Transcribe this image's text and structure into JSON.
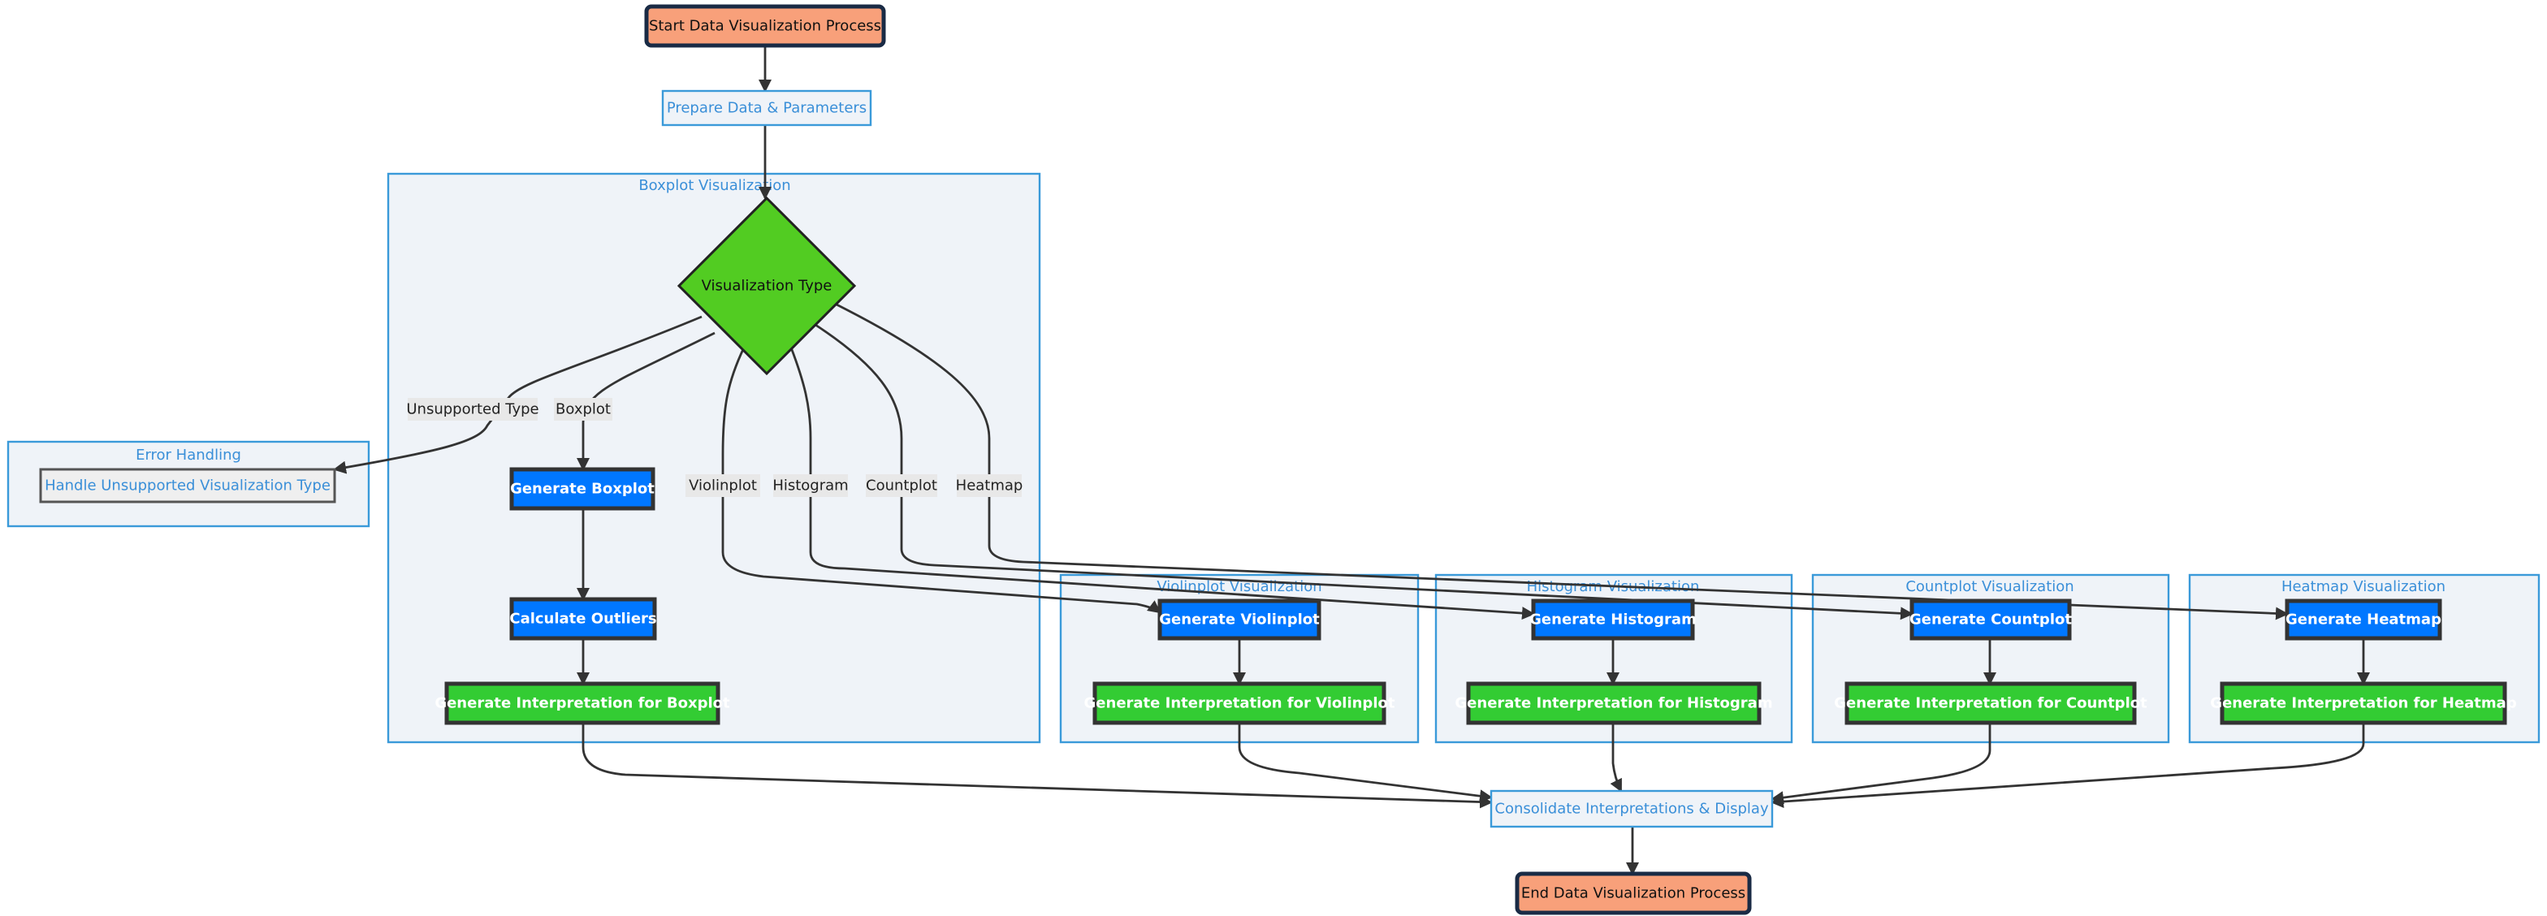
{
  "nodes": {
    "start": "Start Data Visualization Process",
    "prepare": "Prepare Data & Parameters",
    "decision": "Visualization Type",
    "unsupported": "Handle Unsupported Visualization Type",
    "gen_boxplot": "Generate Boxplot",
    "calc_outliers": "Calculate Outliers",
    "interp_boxplot": "Generate Interpretation for Boxplot",
    "gen_violinplot": "Generate Violinplot",
    "interp_violinplot": "Generate Interpretation for Violinplot",
    "gen_histogram": "Generate Histogram",
    "interp_histogram": "Generate Interpretation for Histogram",
    "gen_countplot": "Generate Countplot",
    "interp_countplot": "Generate Interpretation for Countplot",
    "gen_heatmap": "Generate Heatmap",
    "interp_heatmap": "Generate Interpretation for Heatmap",
    "consolidate": "Consolidate Interpretations & Display",
    "end": "End Data Visualization Process"
  },
  "subgraphs": {
    "boxplot": "Boxplot Visualization",
    "error": "Error Handling",
    "violinplot": "Violinplot Visualization",
    "histogram": "Histogram Visualization",
    "countplot": "Countplot Visualization",
    "heatmap": "Heatmap Visualization"
  },
  "edge_labels": {
    "unsupported": "Unsupported Type",
    "boxplot": "Boxplot",
    "violinplot": "Violinplot",
    "histogram": "Histogram",
    "countplot": "Countplot",
    "heatmap": "Heatmap"
  },
  "colors": {
    "terminal": "#f8a07a",
    "process_blue": "#0077ff",
    "interpretation_green": "#33cc33",
    "decision": "#52cc22",
    "subgraph_border": "#3a9ad9"
  }
}
